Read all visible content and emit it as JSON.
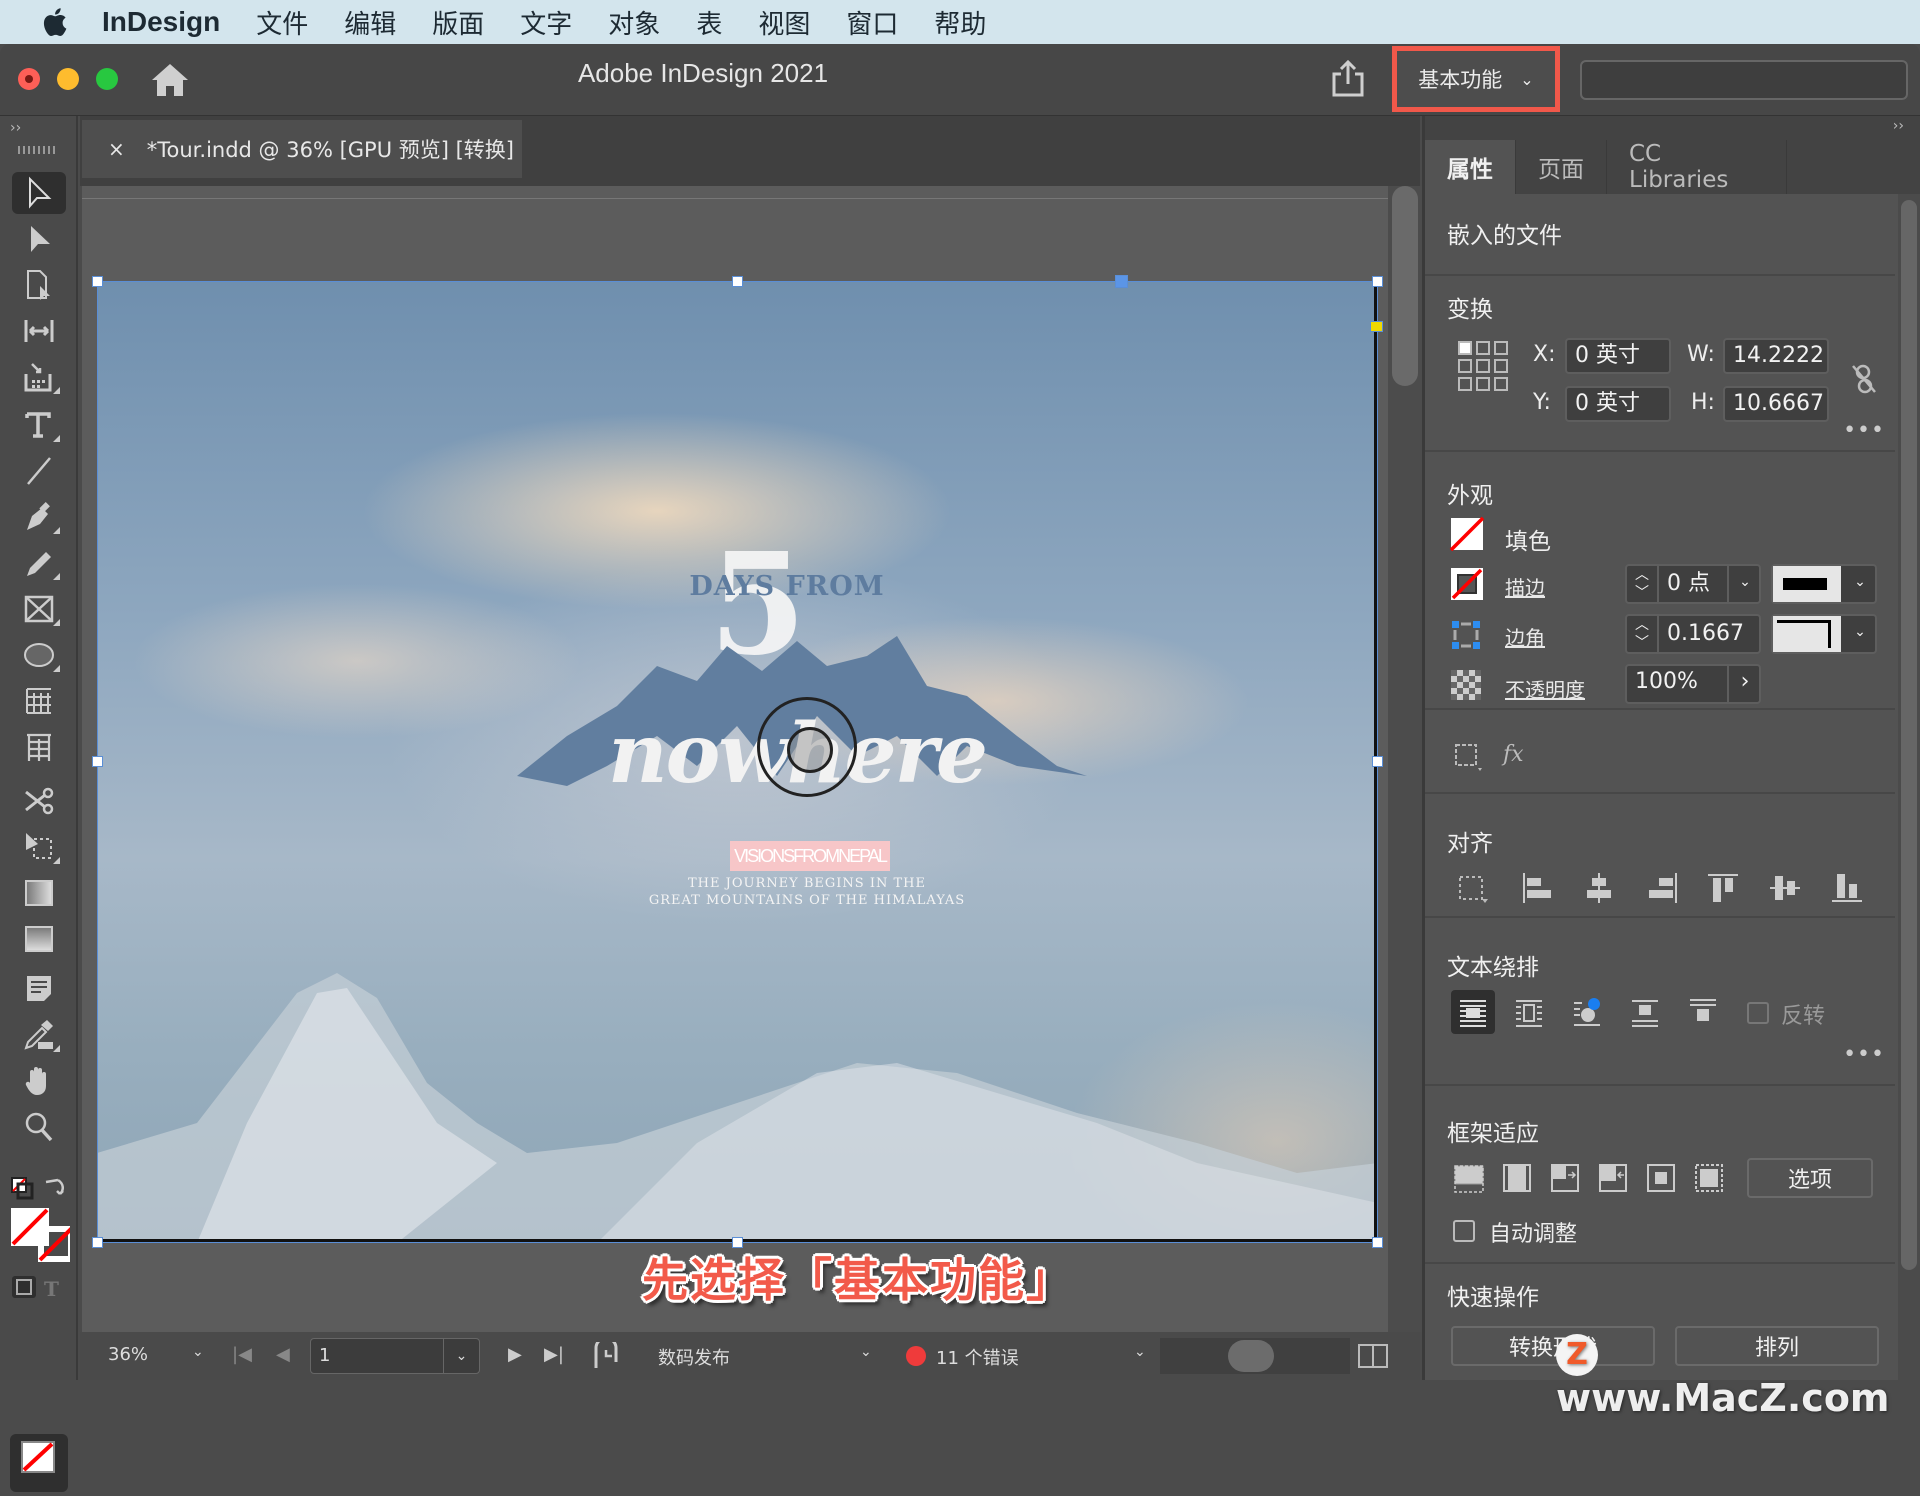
{
  "menubar": {
    "apple_icon": "apple-logo-icon",
    "items": [
      "InDesign",
      "文件",
      "编辑",
      "版面",
      "文字",
      "对象",
      "表",
      "视图",
      "窗口",
      "帮助"
    ]
  },
  "titlebar": {
    "title": "Adobe InDesign 2021",
    "workspace_label": "基本功能",
    "workspace_chevron": "⌄",
    "search_placeholder": "",
    "highlight_color": "#f1584a"
  },
  "toolbar": {
    "collapse": "››",
    "tools": [
      {
        "name": "selection-tool",
        "active": true
      },
      {
        "name": "direct-selection-tool"
      },
      {
        "name": "page-tool"
      },
      {
        "name": "gap-tool"
      },
      {
        "name": "content-collector-tool"
      },
      {
        "name": "type-tool"
      },
      {
        "name": "line-tool"
      },
      {
        "name": "pen-tool"
      },
      {
        "name": "pencil-tool"
      },
      {
        "name": "rectangle-frame-tool"
      },
      {
        "name": "ellipse-tool"
      },
      {
        "name": "table-tool"
      },
      {
        "name": "grid-tool"
      },
      {
        "name": "scissors-tool"
      },
      {
        "name": "free-transform-tool"
      },
      {
        "name": "gradient-swatch-tool"
      },
      {
        "name": "gradient-feather-tool"
      },
      {
        "name": "note-tool"
      },
      {
        "name": "eyedropper-tool"
      },
      {
        "name": "hand-tool"
      },
      {
        "name": "zoom-tool"
      }
    ],
    "format_text_glyph": "T"
  },
  "document": {
    "tab_close": "×",
    "tab_label": "*Tour.indd @ 36% [GPU 预览] [转换]",
    "artwork": {
      "number": "5",
      "days_from": "DAYS FROM",
      "nowhere": "nowhere",
      "vision": "VISIONSFROMNEPAL",
      "tagline_1": "THE JOURNEY BEGINS IN THE",
      "tagline_2": "GREAT MOUNTAINS OF THE HIMALAYAS"
    },
    "caption": "先选择「基本功能」"
  },
  "statusbar": {
    "zoom": "36%",
    "page": "1",
    "mode": "数码发布",
    "errors": "11 个错误",
    "error_color": "#ef3b3b"
  },
  "panel": {
    "collapse": "››",
    "tabs": [
      "属性",
      "页面",
      "CC Libraries"
    ],
    "active_tab": "属性",
    "object_type": "嵌入的文件",
    "transform": {
      "title": "变换",
      "x_label": "X:",
      "x_value": "0 英寸",
      "y_label": "Y:",
      "y_value": "0 英寸",
      "w_label": "W:",
      "w_value": "14.2222",
      "h_label": "H:",
      "h_value": "10.6667",
      "more": "•••"
    },
    "appearance": {
      "title": "外观",
      "fill_label": "填色",
      "stroke_label": "描边",
      "stroke_value": "0 点",
      "corner_label": "边角",
      "corner_value": "0.1667",
      "opacity_label": "不透明度",
      "opacity_value": "100%",
      "fx_label": "fx"
    },
    "align": {
      "title": "对齐"
    },
    "text_wrap": {
      "title": "文本绕排",
      "invert_label": "反转",
      "invert_checked": false,
      "more": "•••"
    },
    "frame_fitting": {
      "title": "框架适应",
      "options_label": "选项",
      "auto_fit_label": "自动调整",
      "auto_fit_checked": false
    },
    "quick_actions": {
      "title": "快速操作",
      "buttons": [
        "转换形状",
        "排列"
      ]
    }
  },
  "watermark": {
    "logo_letter": "Z",
    "text": "www.MacZ.com"
  }
}
